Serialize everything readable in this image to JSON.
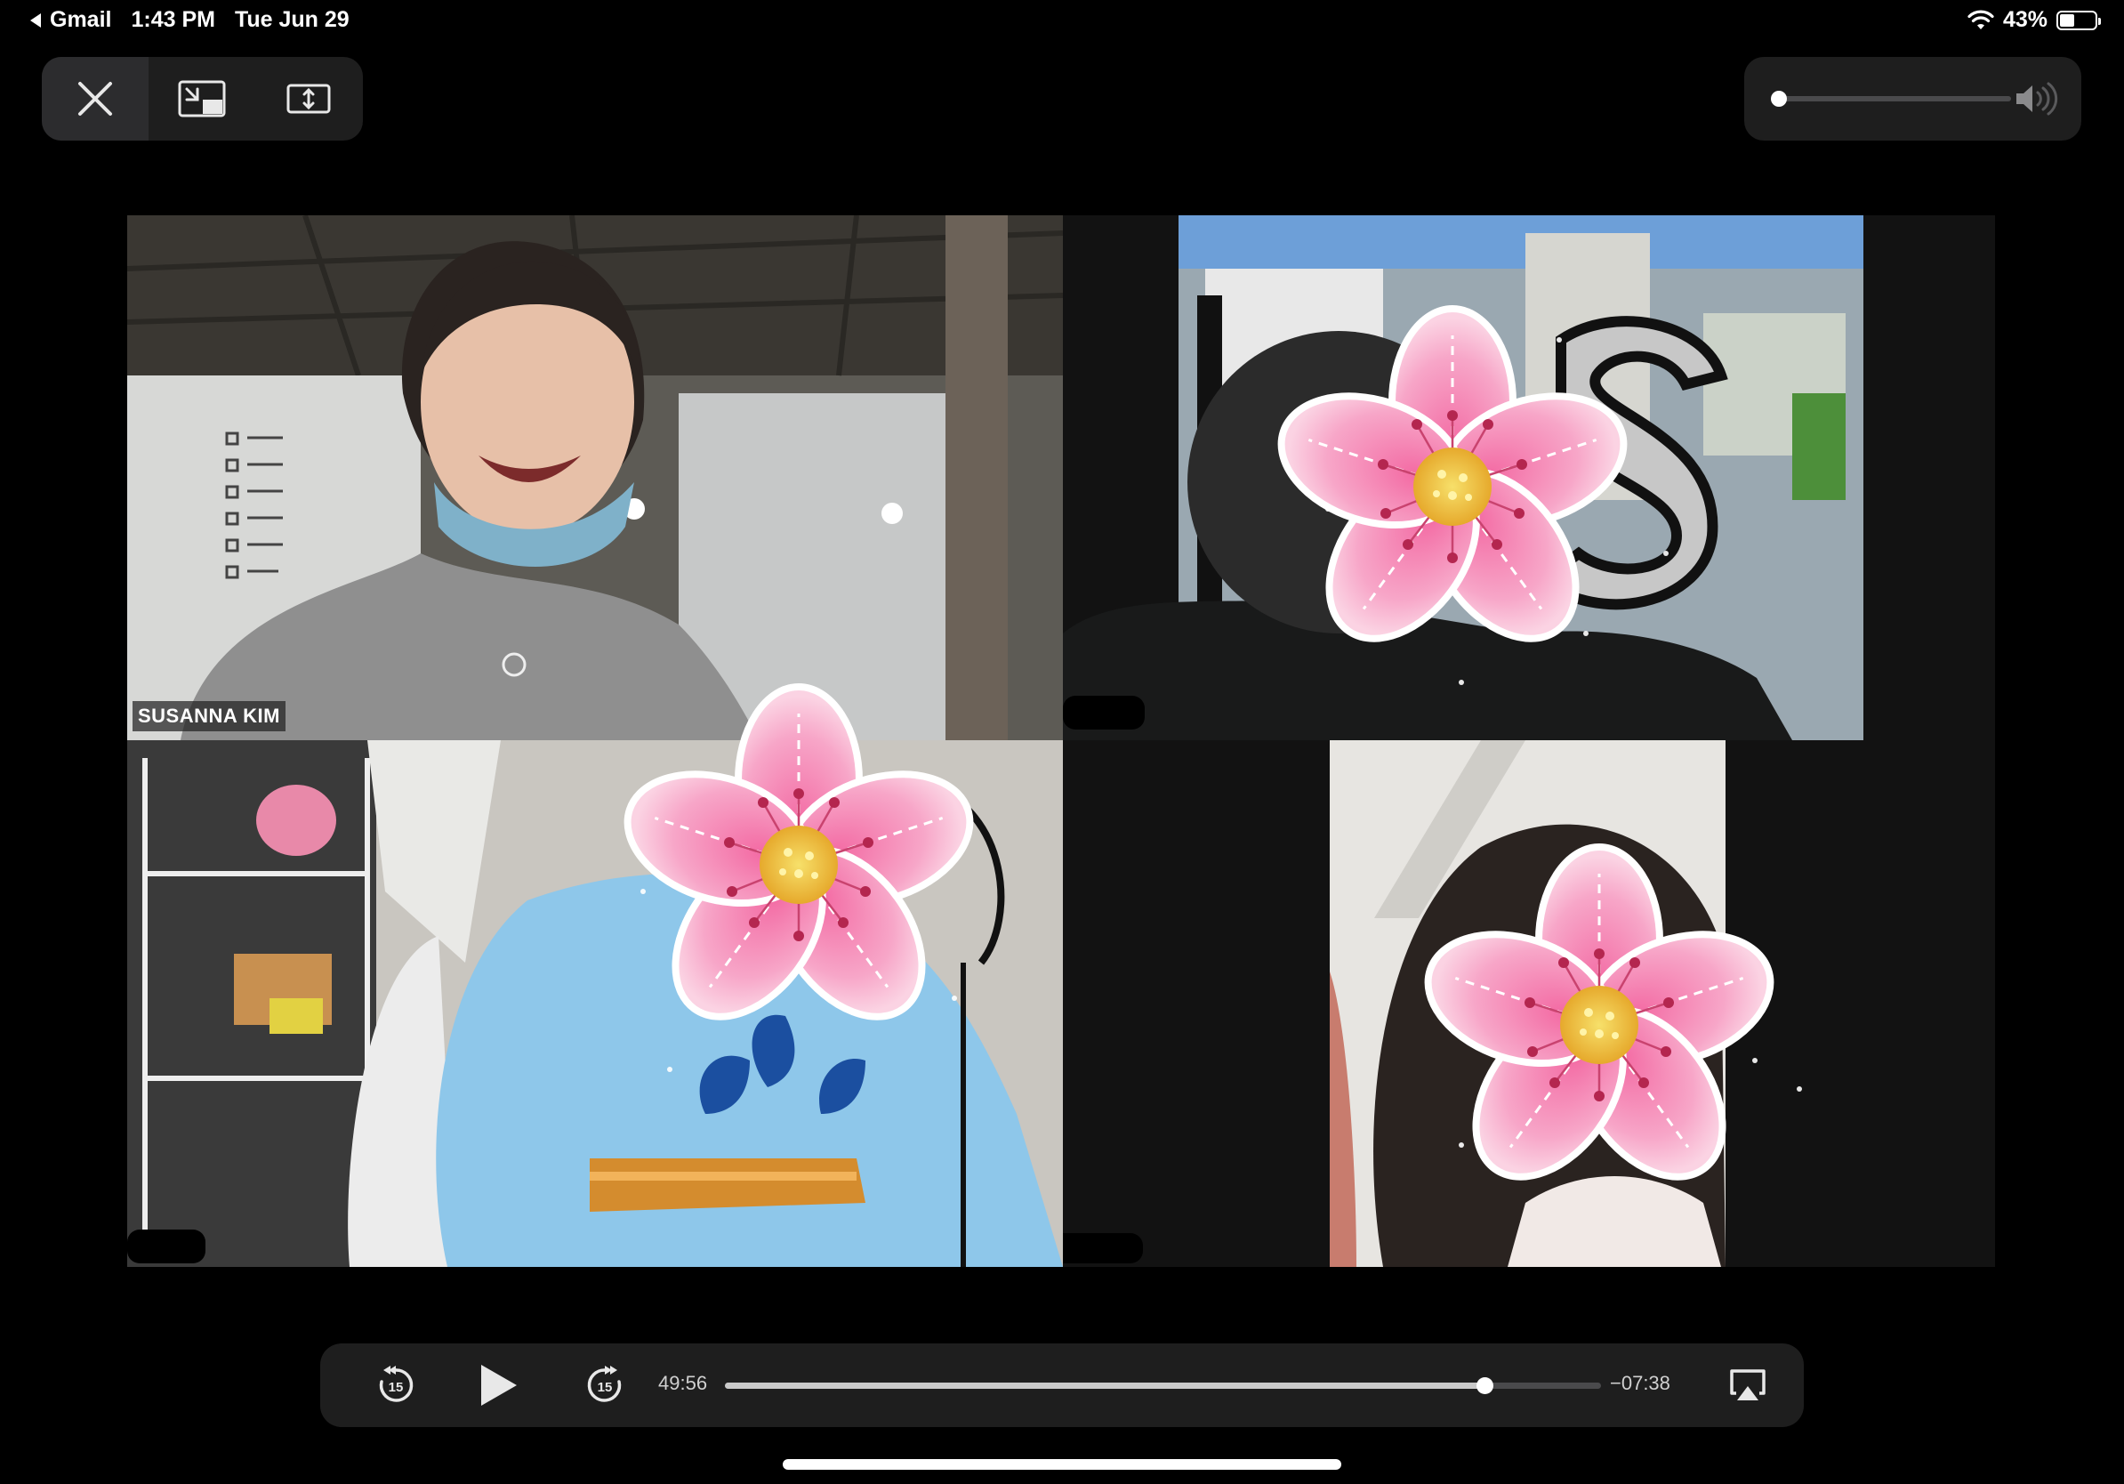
{
  "status_bar": {
    "back_app": "Gmail",
    "time": "1:43 PM",
    "date": "Tue Jun 29",
    "battery_percent_label": "43%",
    "battery_level": 0.43
  },
  "top_controls": {
    "icons": [
      "close-icon",
      "picture-in-picture-icon",
      "aspect-fill-icon"
    ]
  },
  "volume": {
    "level": 0.0,
    "icon": "speaker-icon"
  },
  "video": {
    "participants": [
      {
        "name": "SUSANNA KIM"
      },
      {
        "name": ""
      },
      {
        "name": ""
      },
      {
        "name": ""
      }
    ],
    "colors": {
      "flower_petal": "#f7a6c8",
      "flower_center": "#f2c94c",
      "shirt_gray": "#8f8f8f",
      "shirt_blue": "#8ec7ea"
    }
  },
  "playback": {
    "elapsed": "49:56",
    "remaining": "−07:38",
    "progress": 0.867,
    "skip_back_seconds": "15",
    "skip_forward_seconds": "15",
    "icons": [
      "skip-back-15-icon",
      "play-icon",
      "skip-forward-15-icon",
      "airplay-icon"
    ]
  }
}
